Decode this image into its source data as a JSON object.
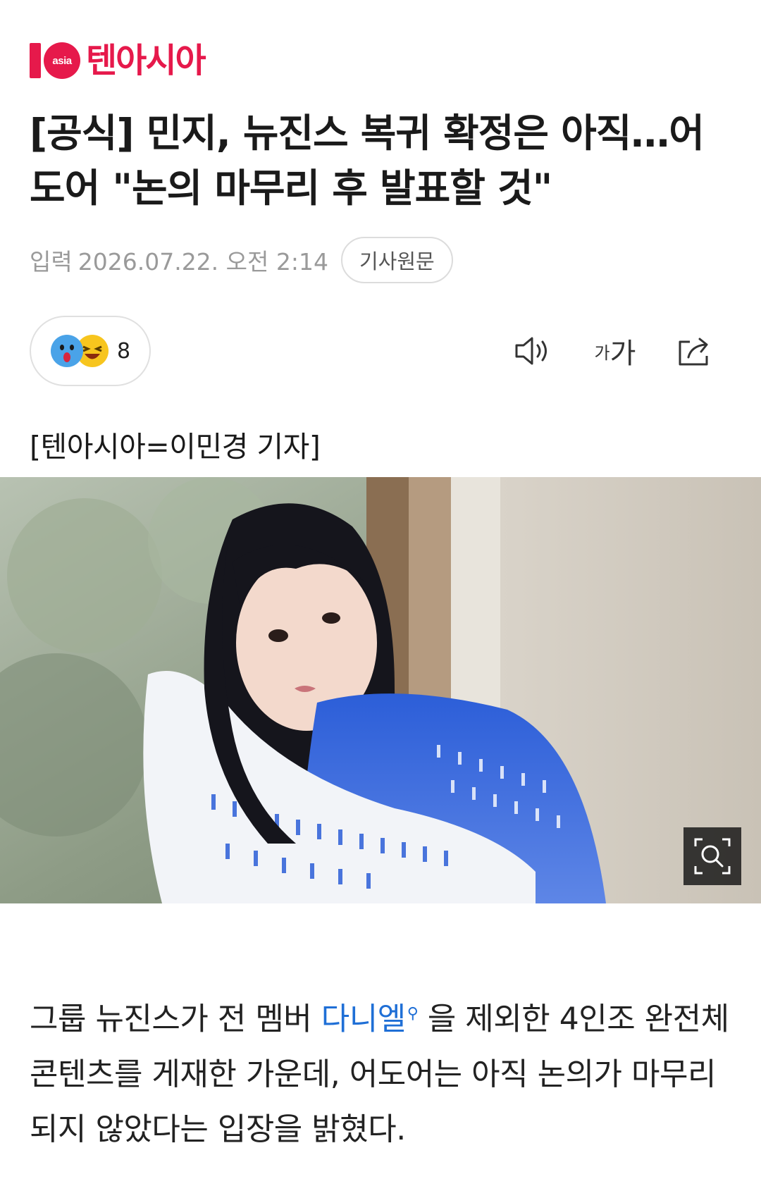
{
  "brand": {
    "logo_badge": "asia",
    "name": "텐아시아",
    "color": "#e6194b"
  },
  "article": {
    "headline": "[공식] 민지, 뉴진스 복귀 확정은 아직…어도어 \"논의 마무리 후 발표할 것\"",
    "input_label": "입력",
    "date": "2026.07.22. 오전 2:14",
    "original_link": "기사원문",
    "reactions": {
      "count": "8",
      "icons": [
        "surprised-emoji-icon",
        "laughing-emoji-icon"
      ]
    },
    "tools": {
      "sound_icon": "speaker-icon",
      "font_small": "가",
      "font_large": "가",
      "share_icon": "share-icon"
    },
    "byline": "[텐아시아=이민경 기자]",
    "photo": {
      "zoom_icon": "zoom-icon"
    },
    "body": {
      "before_link": "그룹 뉴진스가 전 멤버 ",
      "link_text": "다니엘",
      "after_link": " 을 제외한 4인조 완전체 콘텐츠를 게재한 가운데, 어도어는 아직 논의가 마무리되지 않았다는 입장을 밝혔다.",
      "link_color": "#1f6fd6"
    }
  }
}
